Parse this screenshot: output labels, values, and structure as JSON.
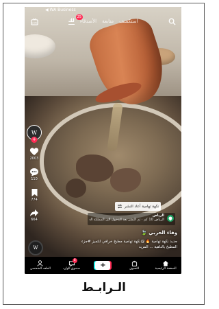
{
  "status_bar": {
    "back_label": "◀ WA Business"
  },
  "top_tabs": [
    {
      "label": "استكشف",
      "active": false
    },
    {
      "label": "متابعة",
      "active": false
    },
    {
      "label": "الأصدقاء",
      "active": false,
      "badge": "25"
    },
    {
      "label": "لك",
      "active": true
    }
  ],
  "actions": {
    "likes": "2003",
    "comments": "110",
    "saves": "774",
    "shares": "664"
  },
  "avatar_glyph": "W",
  "share_pill": {
    "label": "نكهة تهامية أعاد النشر"
  },
  "location": {
    "title": "الرياض",
    "subtitle": "الرياض 10 كم · تم النشر بعد الدخول الى المملكة العربية السعودية"
  },
  "post": {
    "username": "وفاء الحربي 🍃",
    "caption": "جديد نكهة تهامية 🔥 @نكهة تهامية مطبخ خرافي للتميز #جزء المطبخ بالتاهية ... المزيد"
  },
  "bottom_nav": [
    {
      "label": "الملف الشخصي",
      "icon": "profile-icon"
    },
    {
      "label": "صندوق الوارد",
      "icon": "inbox-icon",
      "badge": "8"
    },
    {
      "label": "+",
      "icon": "create-icon"
    },
    {
      "label": "التسوق",
      "icon": "shop-icon"
    },
    {
      "label": "الصفحة الرئيسية",
      "icon": "home-icon"
    }
  ],
  "link_label": "الـرابـط",
  "colors": {
    "accent_red": "#fe2c55",
    "accent_cyan": "#25f4ee",
    "pin_green": "#1ea362"
  }
}
